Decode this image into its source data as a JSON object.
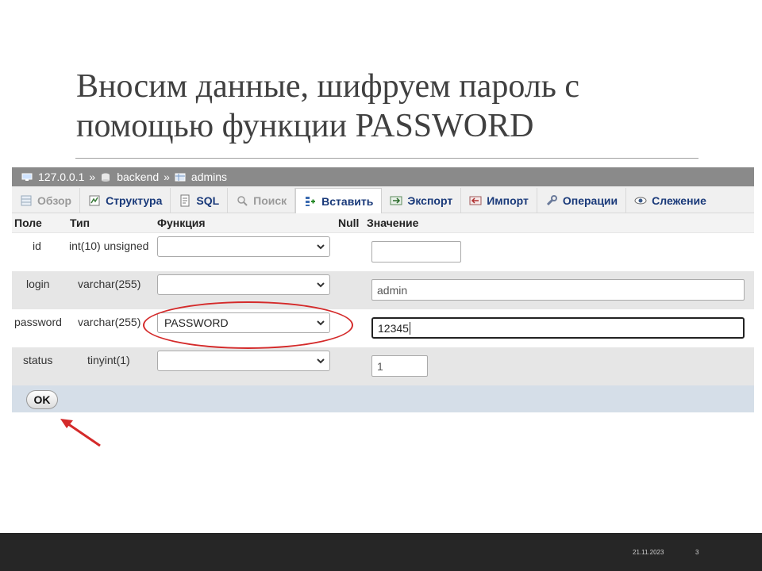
{
  "slide": {
    "title_lines": [
      "Вносим данные, шифруем пароль с",
      "помощью функции PASSWORD"
    ],
    "date": "21.11.2023",
    "page_number": "3"
  },
  "breadcrumb": {
    "server": "127.0.0.1",
    "database": "backend",
    "table": "admins",
    "separator": "»"
  },
  "tabs": [
    {
      "label": "Обзор",
      "icon": "browse-icon",
      "state": "disabled"
    },
    {
      "label": "Структура",
      "icon": "structure-icon",
      "state": "normal"
    },
    {
      "label": "SQL",
      "icon": "sql-icon",
      "state": "normal"
    },
    {
      "label": "Поиск",
      "icon": "search-icon",
      "state": "disabled"
    },
    {
      "label": "Вставить",
      "icon": "insert-icon",
      "state": "active"
    },
    {
      "label": "Экспорт",
      "icon": "export-icon",
      "state": "normal"
    },
    {
      "label": "Импорт",
      "icon": "import-icon",
      "state": "normal"
    },
    {
      "label": "Операции",
      "icon": "wrench-icon",
      "state": "normal"
    },
    {
      "label": "Слежение",
      "icon": "eye-icon",
      "state": "normal"
    }
  ],
  "table": {
    "headers": {
      "field": "Поле",
      "type": "Тип",
      "function": "Функция",
      "null": "Null",
      "value": "Значение"
    },
    "rows": [
      {
        "field": "id",
        "type": "int(10) unsigned",
        "function": "",
        "value": ""
      },
      {
        "field": "login",
        "type": "varchar(255)",
        "function": "",
        "value": "admin"
      },
      {
        "field": "password",
        "type": "varchar(255)",
        "function": "PASSWORD",
        "value": "12345"
      },
      {
        "field": "status",
        "type": "tinyint(1)",
        "function": "",
        "value": "1"
      }
    ]
  },
  "submit": {
    "label": "OK"
  },
  "colors": {
    "annotation": "#d42a2a",
    "tab_text": "#1a3a7a",
    "footer_bar": "#262626"
  }
}
